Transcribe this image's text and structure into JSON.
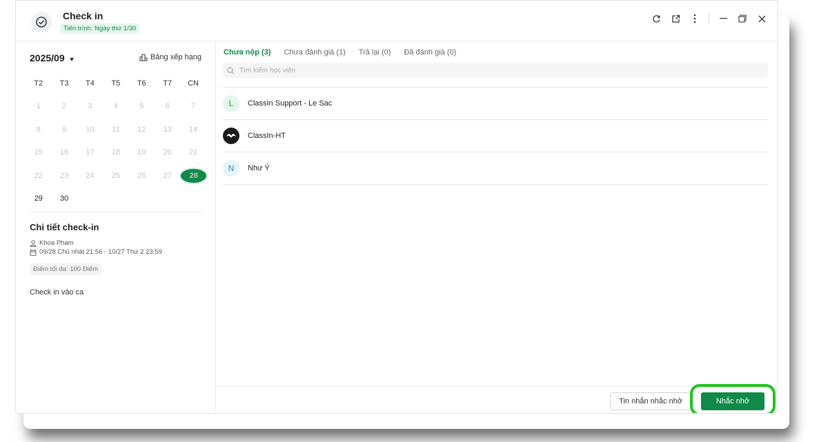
{
  "header": {
    "title": "Check in",
    "progress": "Tiến trình: Ngày thứ 1/30",
    "controls": [
      "refresh-icon",
      "popout-icon",
      "more-icon",
      "minimize-icon",
      "restore-icon",
      "close-icon"
    ]
  },
  "calendar": {
    "month": "2025/09",
    "ranking_label": "Bảng xếp hạng",
    "weekdays": [
      "T2",
      "T3",
      "T4",
      "T5",
      "T6",
      "T7",
      "CN"
    ],
    "weeks": [
      [
        "1",
        "2",
        "3",
        "4",
        "5",
        "6",
        "7"
      ],
      [
        "8",
        "9",
        "10",
        "11",
        "12",
        "13",
        "14"
      ],
      [
        "15",
        "16",
        "17",
        "18",
        "19",
        "20",
        "21"
      ],
      [
        "22",
        "23",
        "24",
        "25",
        "26",
        "27",
        "28"
      ],
      [
        "29",
        "30",
        "",
        "",
        "",
        "",
        ""
      ]
    ],
    "today": "28"
  },
  "detail": {
    "title": "Chi tiết check-in",
    "teacher": "Khoa Pham",
    "period": "09/28 Chủ nhật 21:56 - 10/27 Thứ 2 23:59",
    "max_score": "Điểm tối đa: 100 Điểm",
    "description": "Check in vào ca"
  },
  "tabs": [
    {
      "label": "Chưa nộp (3)",
      "active": true
    },
    {
      "label": "Chưa đánh giá (1)",
      "active": false
    },
    {
      "label": "Trả lại (0)",
      "active": false
    },
    {
      "label": "Đã đánh giá (0)",
      "active": false
    }
  ],
  "search": {
    "placeholder": "Tìm kiếm học viên",
    "value": ""
  },
  "students": [
    {
      "initial": "L",
      "name": "ClassIn Support - Le Sac"
    },
    {
      "initial": "",
      "name": "ClassIn-HT"
    },
    {
      "initial": "N",
      "name": "Như Ý"
    }
  ],
  "footer": {
    "message_button": "Tin nhắn nhắc nhở",
    "remind_button": "Nhắc nhở"
  },
  "colors": {
    "accent": "#0f8a48",
    "highlight_ring": "#1dc41d"
  }
}
